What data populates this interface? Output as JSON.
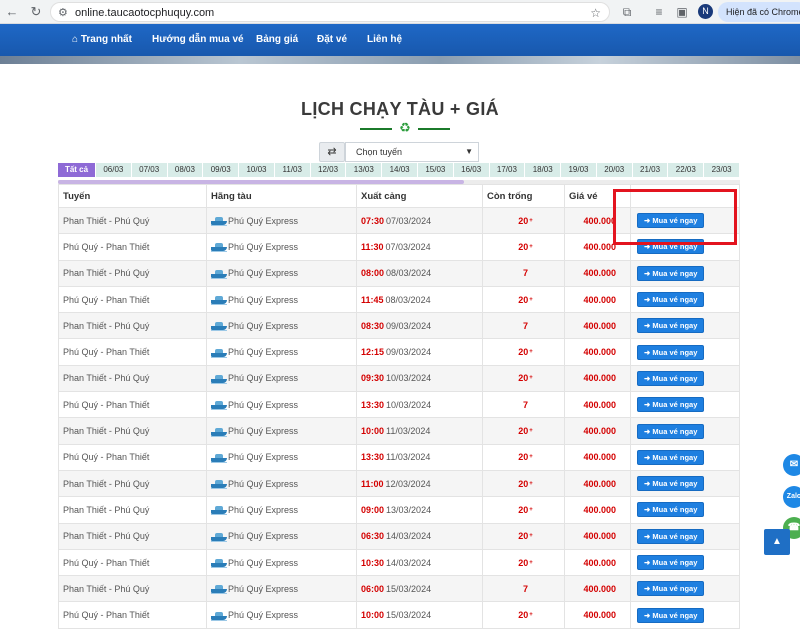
{
  "browser": {
    "url": "online.taucaotocphuquy.com",
    "profile_initial": "N",
    "update_text": "Hiện đã có Chrome mới"
  },
  "nav": {
    "items": [
      "Trang nhất",
      "Hướng dẫn mua vé",
      "Bảng giá",
      "Đặt vé",
      "Liên hệ"
    ]
  },
  "title": "LỊCH CHẠY TÀU + GIÁ",
  "route_select": {
    "value": "Chọn tuyến"
  },
  "date_tabs": [
    "Tất cả",
    "06/03",
    "07/03",
    "08/03",
    "09/03",
    "10/03",
    "11/03",
    "12/03",
    "13/03",
    "14/03",
    "15/03",
    "16/03",
    "17/03",
    "18/03",
    "19/03",
    "20/03",
    "21/03",
    "22/03",
    "23/03"
  ],
  "table": {
    "headers": [
      "Tuyến",
      "Hãng tàu",
      "Xuất cảng",
      "Còn trống",
      "Giá vé"
    ],
    "buy_label": "Mua vé ngay",
    "seats_suffix": "+",
    "rows": [
      {
        "route": "Phan Thiết - Phú Quý",
        "company": "Phú Quý Express",
        "time": "07:30",
        "date": "07/03/2024",
        "seats": "20",
        "plus": true,
        "price": "400.000"
      },
      {
        "route": "Phú Quý - Phan Thiết",
        "company": "Phú Quý Express",
        "time": "11:30",
        "date": "07/03/2024",
        "seats": "20",
        "plus": true,
        "price": "400.000"
      },
      {
        "route": "Phan Thiết - Phú Quý",
        "company": "Phú Quý Express",
        "time": "08:00",
        "date": "08/03/2024",
        "seats": "7",
        "plus": false,
        "price": "400.000"
      },
      {
        "route": "Phú Quý - Phan Thiết",
        "company": "Phú Quý Express",
        "time": "11:45",
        "date": "08/03/2024",
        "seats": "20",
        "plus": true,
        "price": "400.000"
      },
      {
        "route": "Phan Thiết - Phú Quý",
        "company": "Phú Quý Express",
        "time": "08:30",
        "date": "09/03/2024",
        "seats": "7",
        "plus": false,
        "price": "400.000"
      },
      {
        "route": "Phú Quý - Phan Thiết",
        "company": "Phú Quý Express",
        "time": "12:15",
        "date": "09/03/2024",
        "seats": "20",
        "plus": true,
        "price": "400.000"
      },
      {
        "route": "Phan Thiết - Phú Quý",
        "company": "Phú Quý Express",
        "time": "09:30",
        "date": "10/03/2024",
        "seats": "20",
        "plus": true,
        "price": "400.000"
      },
      {
        "route": "Phú Quý - Phan Thiết",
        "company": "Phú Quý Express",
        "time": "13:30",
        "date": "10/03/2024",
        "seats": "7",
        "plus": false,
        "price": "400.000"
      },
      {
        "route": "Phan Thiết - Phú Quý",
        "company": "Phú Quý Express",
        "time": "10:00",
        "date": "11/03/2024",
        "seats": "20",
        "plus": true,
        "price": "400.000"
      },
      {
        "route": "Phú Quý - Phan Thiết",
        "company": "Phú Quý Express",
        "time": "13:30",
        "date": "11/03/2024",
        "seats": "20",
        "plus": true,
        "price": "400.000"
      },
      {
        "route": "Phan Thiết - Phú Quý",
        "company": "Phú Quý Express",
        "time": "11:00",
        "date": "12/03/2024",
        "seats": "20",
        "plus": true,
        "price": "400.000"
      },
      {
        "route": "Phan Thiết - Phú Quý",
        "company": "Phú Quý Express",
        "time": "09:00",
        "date": "13/03/2024",
        "seats": "20",
        "plus": true,
        "price": "400.000"
      },
      {
        "route": "Phan Thiết - Phú Quý",
        "company": "Phú Quý Express",
        "time": "06:30",
        "date": "14/03/2024",
        "seats": "20",
        "plus": true,
        "price": "400.000"
      },
      {
        "route": "Phú Quý - Phan Thiết",
        "company": "Phú Quý Express",
        "time": "10:30",
        "date": "14/03/2024",
        "seats": "20",
        "plus": true,
        "price": "400.000"
      },
      {
        "route": "Phan Thiết - Phú Quý",
        "company": "Phú Quý Express",
        "time": "06:00",
        "date": "15/03/2024",
        "seats": "7",
        "plus": false,
        "price": "400.000"
      },
      {
        "route": "Phú Quý - Phan Thiết",
        "company": "Phú Quý Express",
        "time": "10:00",
        "date": "15/03/2024",
        "seats": "20",
        "plus": true,
        "price": "400.000"
      }
    ]
  },
  "floating": {
    "messenger_color": "#1e88e5",
    "zalo_label": "Zalo",
    "zalo_color": "#1e88e5",
    "phone_color": "#4caf50"
  },
  "icons": {
    "home": "home-icon",
    "swap": "swap-icon",
    "arrow": "arrow-right-icon",
    "recycle": "recycle-icon"
  }
}
